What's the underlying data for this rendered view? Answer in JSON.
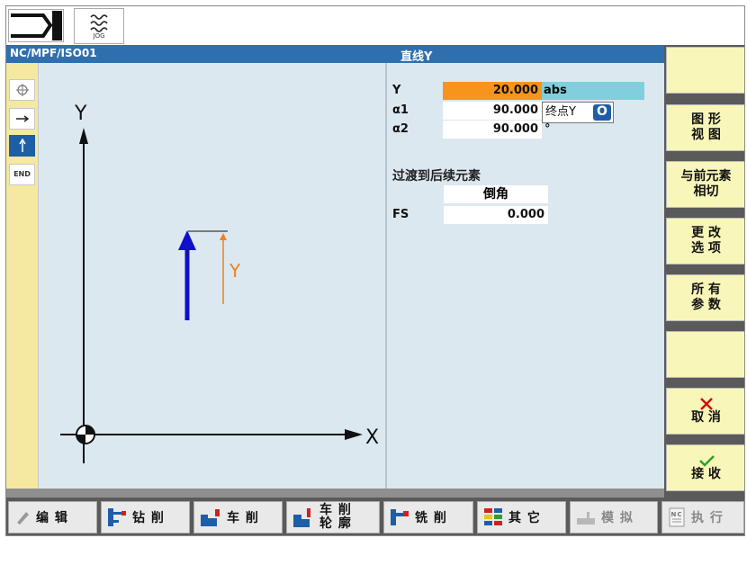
{
  "header": {
    "program": "NC/MPF/ISO01",
    "dialog_title": "直线Y",
    "jog_label": "JOG"
  },
  "left_strip": [
    "END"
  ],
  "graph": {
    "y_axis": "Y",
    "x_axis": "X",
    "arrow_label": "Y"
  },
  "params": {
    "y": {
      "label": "Y",
      "value": "20.000",
      "unit": "abs"
    },
    "a1": {
      "label": "α1",
      "value": "90.000"
    },
    "a2": {
      "label": "α2",
      "value": "90.000",
      "unit": "°"
    },
    "tooltip": "终点Y",
    "transition_heading": "过渡到后续元素",
    "transition_type": "倒角",
    "fs": {
      "label": "FS",
      "value": "0.000"
    }
  },
  "softkeys": {
    "graphic_view": [
      "图 形",
      "视 图"
    ],
    "tangent": [
      "与前元素",
      "相切"
    ],
    "change": [
      "更 改",
      "选 项"
    ],
    "all_params": [
      "所 有",
      "参 数"
    ],
    "cancel": "取 消",
    "accept": "接 收"
  },
  "hkeys": {
    "edit": "编 辑",
    "drill": "钻 削",
    "turn": "车 削",
    "contour1": "车 削",
    "contour2": "轮 廓",
    "mill": "铣 削",
    "other": "其 它",
    "simulate": "模 拟",
    "execute": "执 行",
    "nc_icon": "NC"
  },
  "colors": {
    "titlebar": "#2f6fae",
    "highlight": "#f7941d",
    "softkey": "#f8f6b8",
    "arrow": "#1010c8",
    "dim": "#f08020"
  }
}
